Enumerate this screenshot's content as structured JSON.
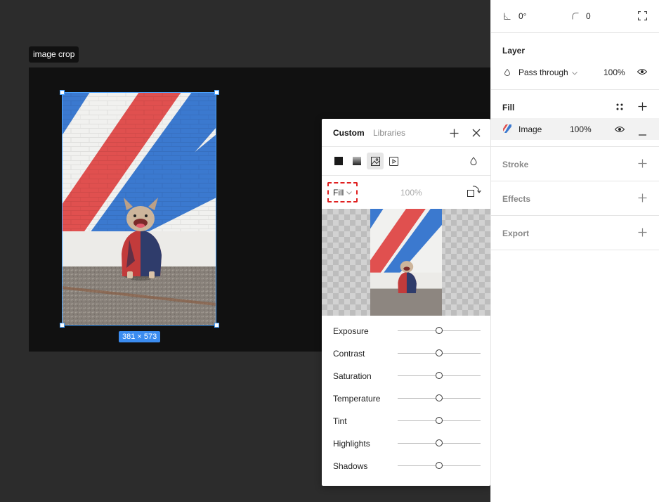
{
  "canvas": {
    "frame_label": "image crop",
    "selection_dims": "381 × 573"
  },
  "popover": {
    "tabs": {
      "custom": "Custom",
      "libraries": "Libraries"
    },
    "fill_mode": "Fill",
    "opacity": "100%",
    "adjustments": [
      {
        "label": "Exposure",
        "value": 0.5
      },
      {
        "label": "Contrast",
        "value": 0.5
      },
      {
        "label": "Saturation",
        "value": 0.5
      },
      {
        "label": "Temperature",
        "value": 0.5
      },
      {
        "label": "Tint",
        "value": 0.5
      },
      {
        "label": "Highlights",
        "value": 0.5
      },
      {
        "label": "Shadows",
        "value": 0.5
      }
    ]
  },
  "panel": {
    "rotation": "0°",
    "corner_radius": "0",
    "layer": {
      "title": "Layer",
      "blend_mode": "Pass through",
      "opacity": "100%"
    },
    "fill": {
      "title": "Fill",
      "item_label": "Image",
      "item_opacity": "100%"
    },
    "stroke": {
      "title": "Stroke"
    },
    "effects": {
      "title": "Effects"
    },
    "export": {
      "title": "Export"
    }
  },
  "colors": {
    "selection": "#4aa3ff",
    "dims_badge": "#3b8cf0",
    "highlight_dash": "#e02020"
  }
}
